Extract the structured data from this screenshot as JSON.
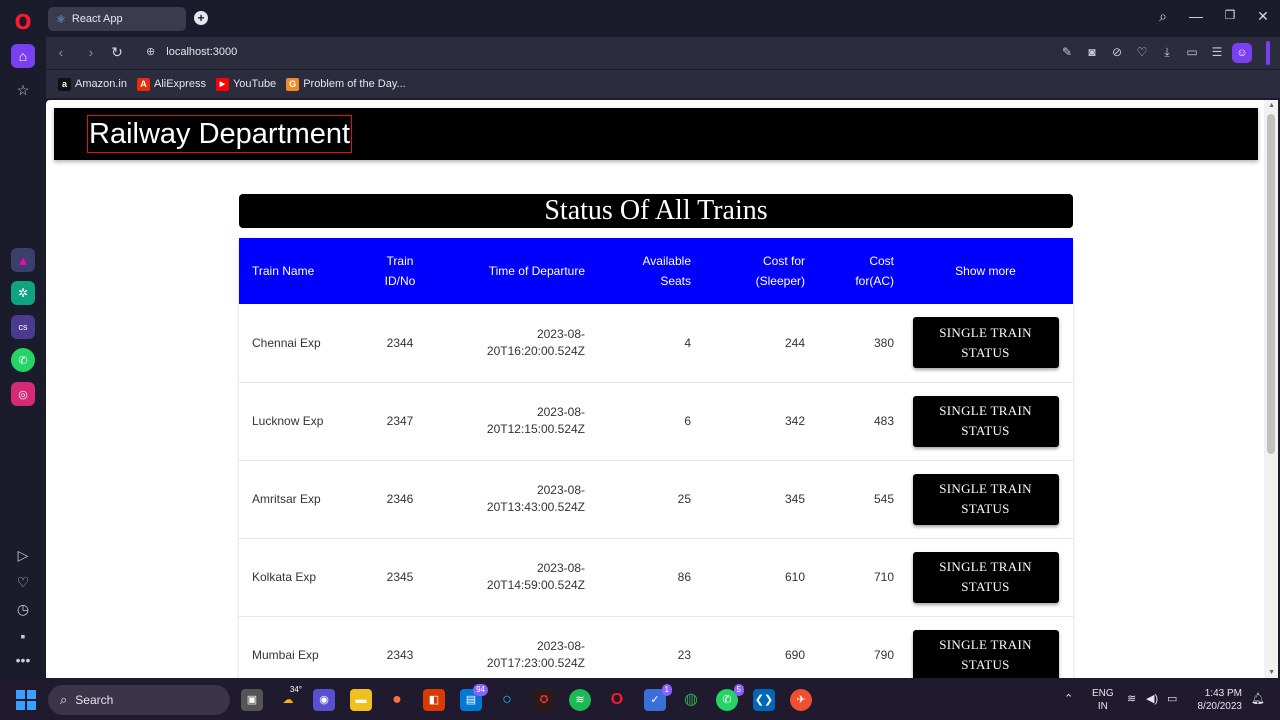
{
  "browser": {
    "tab_title": "React App",
    "url": "localhost:3000",
    "bookmarks": [
      {
        "label": "Amazon.in",
        "color": "#111111",
        "glyph": "a"
      },
      {
        "label": "AliExpress",
        "color": "#e62e04",
        "glyph": "A"
      },
      {
        "label": "YouTube",
        "color": "#ff0000",
        "glyph": "▶"
      },
      {
        "label": "Problem of the Day...",
        "color": "#f08a24",
        "glyph": "G"
      }
    ]
  },
  "app": {
    "title": "Railway Department",
    "heading": "Status Of All Trains",
    "columns": {
      "name": "Train Name",
      "id_line1": "Train",
      "id_line2": "ID/No",
      "time": "Time of Departure",
      "seats_line1": "Available",
      "seats_line2": "Seats",
      "sleeper_line1": "Cost for",
      "sleeper_line2": "(Sleeper)",
      "ac_line1": "Cost",
      "ac_line2": "for(AC)",
      "more": "Show more"
    },
    "button_line1": "SINGLE TRAIN",
    "button_line2": "STATUS",
    "trains": [
      {
        "name": "Chennai Exp",
        "id": "2344",
        "time1": "2023-08-",
        "time2": "20T16:20:00.524Z",
        "seats": "4",
        "sleeper": "244",
        "ac": "380"
      },
      {
        "name": "Lucknow Exp",
        "id": "2347",
        "time1": "2023-08-",
        "time2": "20T12:15:00.524Z",
        "seats": "6",
        "sleeper": "342",
        "ac": "483"
      },
      {
        "name": "Amritsar Exp",
        "id": "2346",
        "time1": "2023-08-",
        "time2": "20T13:43:00.524Z",
        "seats": "25",
        "sleeper": "345",
        "ac": "545"
      },
      {
        "name": "Kolkata Exp",
        "id": "2345",
        "time1": "2023-08-",
        "time2": "20T14:59:00.524Z",
        "seats": "86",
        "sleeper": "610",
        "ac": "710"
      },
      {
        "name": "Mumbai Exp",
        "id": "2343",
        "time1": "2023-08-",
        "time2": "20T17:23:00.524Z",
        "seats": "23",
        "sleeper": "690",
        "ac": "790"
      }
    ]
  },
  "taskbar": {
    "search_placeholder": "Search",
    "weather": "34°",
    "teams_badge": "94",
    "vpn_badge": "1",
    "whatsapp_badge": "5",
    "lang_line1": "ENG",
    "lang_line2": "IN",
    "time": "1:43 PM",
    "date": "8/20/2023"
  }
}
